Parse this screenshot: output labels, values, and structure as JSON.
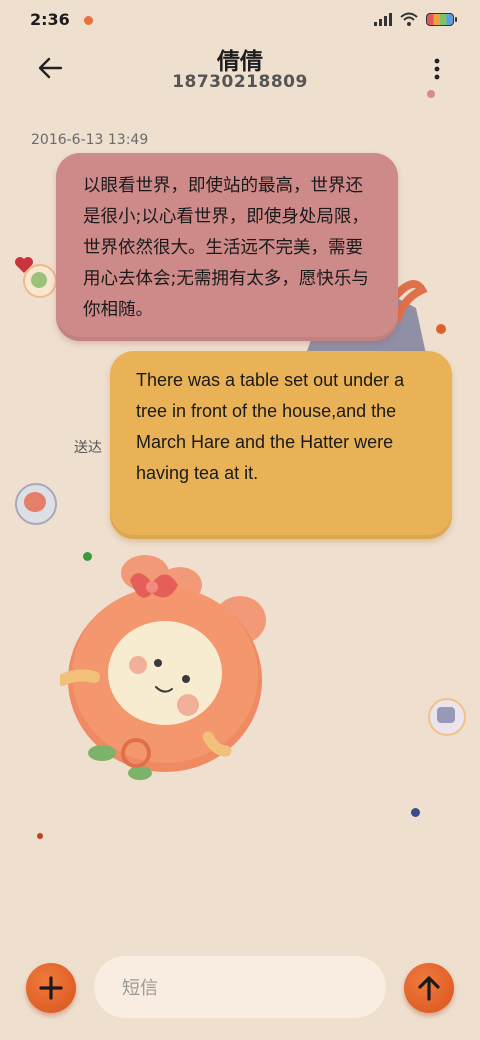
{
  "status": {
    "time": "2:36"
  },
  "header": {
    "title": "倩倩",
    "subtitle": "18730218809"
  },
  "conversation": {
    "timestamp": "2016-6-13 13:49",
    "messages": [
      {
        "text": "以眼看世界，即使站的最高，世界还是很小;以心看世界，即使身处局限，世界依然很大。生活远不完美，需要用心去体会;无需拥有太多，愿快乐与你相随。"
      },
      {
        "text": "There was a table set out under a tree in front of the house,and the March Hare and the Hatter were having tea at it."
      }
    ],
    "delivery_status": "送达"
  },
  "composer": {
    "placeholder": "短信"
  },
  "colors": {
    "background": "#efdfcf",
    "bubble_received": "#cd8a88",
    "bubble_sent": "#e9b257",
    "accent": "#e0602a"
  },
  "icons": [
    "back-arrow-icon",
    "more-vertical-icon",
    "add-icon",
    "send-arrow-icon",
    "signal-icon",
    "wifi-icon",
    "battery-icon"
  ]
}
